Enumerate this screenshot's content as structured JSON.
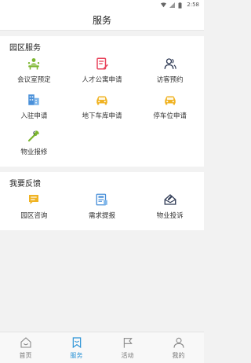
{
  "status": {
    "time": "2:58"
  },
  "header": {
    "title": "服务"
  },
  "park_services": {
    "title": "园区服务",
    "items": [
      {
        "label": "会议室预定",
        "icon": "meeting-room-icon",
        "color": "#7cb62f"
      },
      {
        "label": "人才公寓申请",
        "icon": "apartment-form-icon",
        "color": "#e8455d"
      },
      {
        "label": "访客预约",
        "icon": "visitor-icon",
        "color": "#2f3a55"
      },
      {
        "label": "入驻申请",
        "icon": "building-icon",
        "color": "#4a90d9"
      },
      {
        "label": "地下车库申请",
        "icon": "car-icon",
        "color": "#f0b323"
      },
      {
        "label": "停车位申请",
        "icon": "car-icon",
        "color": "#f0b323"
      },
      {
        "label": "物业报修",
        "icon": "wrench-icon",
        "color": "#7cb62f"
      }
    ]
  },
  "feedback": {
    "title": "我要反馈",
    "items": [
      {
        "label": "园区咨询",
        "icon": "chat-icon",
        "color": "#f0b323"
      },
      {
        "label": "需求提报",
        "icon": "document-icon",
        "color": "#4a90d9"
      },
      {
        "label": "物业投诉",
        "icon": "complaint-icon",
        "color": "#2f3a55"
      }
    ]
  },
  "tabbar": {
    "active_color": "#2b93d6",
    "items": [
      {
        "label": "首页",
        "icon": "home-icon",
        "active": false
      },
      {
        "label": "服务",
        "icon": "service-icon",
        "active": true
      },
      {
        "label": "活动",
        "icon": "flag-icon",
        "active": false
      },
      {
        "label": "我的",
        "icon": "user-icon",
        "active": false
      }
    ]
  }
}
